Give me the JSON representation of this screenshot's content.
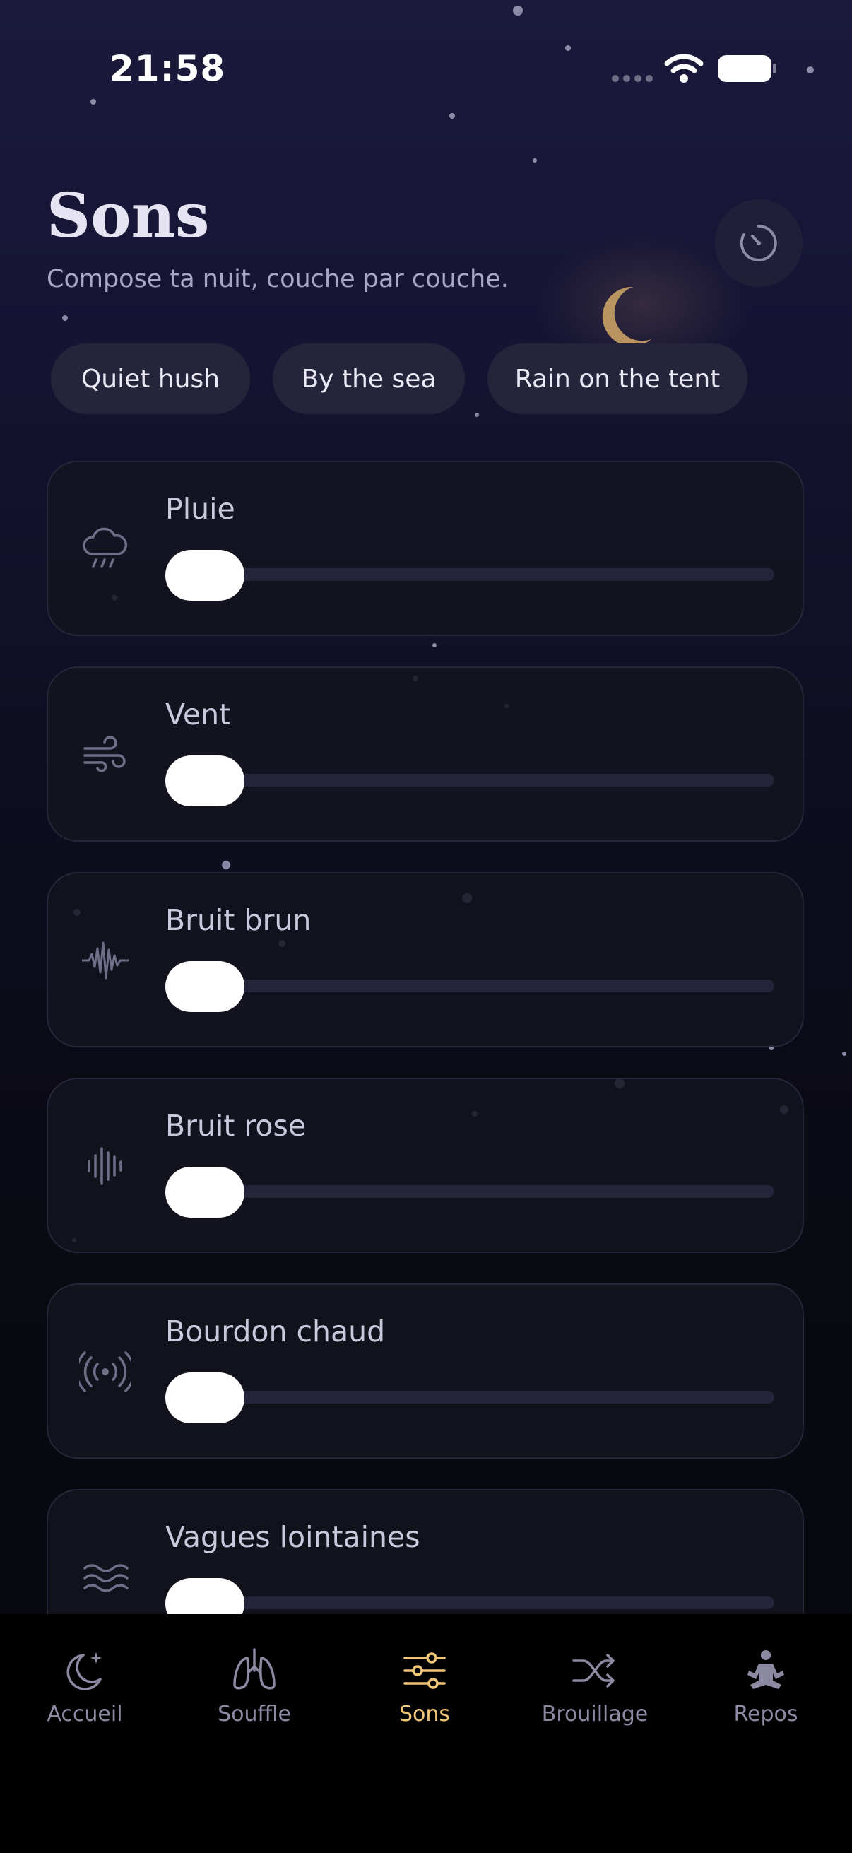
{
  "status_bar": {
    "time": "21:58"
  },
  "header": {
    "title": "Sons",
    "subtitle": "Compose ta nuit, couche par couche."
  },
  "presets": [
    "Quiet hush",
    "By the sea",
    "Rain on the tent"
  ],
  "sounds": [
    {
      "label": "Pluie",
      "icon": "cloud-rain-icon",
      "volume": 0
    },
    {
      "label": "Vent",
      "icon": "wind-icon",
      "volume": 0
    },
    {
      "label": "Bruit brun",
      "icon": "waveform-icon",
      "volume": 0
    },
    {
      "label": "Bruit rose",
      "icon": "bars-waveform-icon",
      "volume": 0
    },
    {
      "label": "Bourdon chaud",
      "icon": "broadcast-icon",
      "volume": 0
    },
    {
      "label": "Vagues lointaines",
      "icon": "waves-icon",
      "volume": 0
    }
  ],
  "tabs": [
    {
      "label": "Accueil",
      "icon": "moon-stars-icon",
      "active": false
    },
    {
      "label": "Souffle",
      "icon": "lungs-icon",
      "active": false
    },
    {
      "label": "Sons",
      "icon": "sliders-icon",
      "active": true
    },
    {
      "label": "Brouillage",
      "icon": "shuffle-icon",
      "active": false
    },
    {
      "label": "Repos",
      "icon": "meditation-icon",
      "active": false
    }
  ],
  "colors": {
    "accent": "#f2c679",
    "inactive_tab": "#8b8aa2",
    "card_bg": "#141420",
    "track": "#24243a",
    "thumb": "#ffffff"
  }
}
